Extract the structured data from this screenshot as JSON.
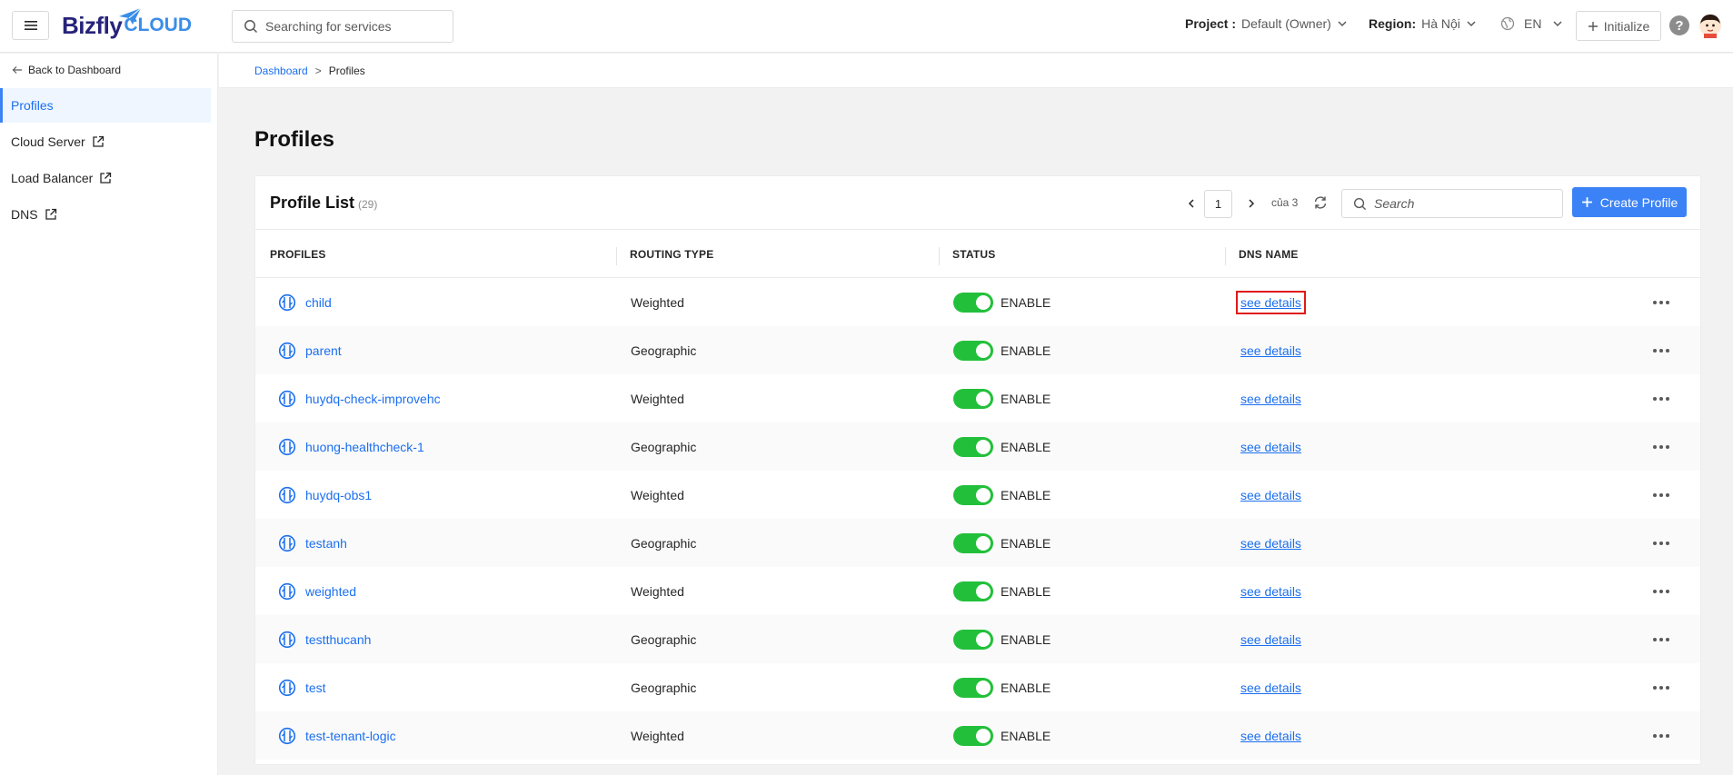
{
  "header": {
    "logo_main": "Bizfly",
    "logo_sub": "CLOUD",
    "search_placeholder": "Searching for services",
    "project_label": "Project :",
    "project_value": "Default (Owner)",
    "region_label": "Region:",
    "region_value": "Hà Nội",
    "language": "EN",
    "initialize_label": "Initialize",
    "help_glyph": "?"
  },
  "sidebar": {
    "back_label": "Back to Dashboard",
    "items": [
      {
        "label": "Profiles",
        "active": true,
        "external": false
      },
      {
        "label": "Cloud Server",
        "active": false,
        "external": true
      },
      {
        "label": "Load Balancer",
        "active": false,
        "external": true
      },
      {
        "label": "DNS",
        "active": false,
        "external": true
      }
    ]
  },
  "breadcrumb": {
    "items": [
      "Dashboard",
      "Profiles"
    ],
    "separator": ">"
  },
  "page": {
    "title": "Profiles"
  },
  "list": {
    "title": "Profile List",
    "count": "(29)",
    "current_page": "1",
    "total_pages": "của 3",
    "search_placeholder": "Search",
    "create_label": "Create Profile",
    "columns": [
      "PROFILES",
      "ROUTING TYPE",
      "STATUS",
      "DNS NAME"
    ],
    "rows": [
      {
        "name": "child",
        "routing": "Weighted",
        "status": "ENABLE",
        "dns": "see details"
      },
      {
        "name": "parent",
        "routing": "Geographic",
        "status": "ENABLE",
        "dns": "see details"
      },
      {
        "name": "huydq-check-improvehc",
        "routing": "Weighted",
        "status": "ENABLE",
        "dns": "see details"
      },
      {
        "name": "huong-healthcheck-1",
        "routing": "Geographic",
        "status": "ENABLE",
        "dns": "see details"
      },
      {
        "name": "huydq-obs1",
        "routing": "Weighted",
        "status": "ENABLE",
        "dns": "see details"
      },
      {
        "name": "testanh",
        "routing": "Geographic",
        "status": "ENABLE",
        "dns": "see details"
      },
      {
        "name": "weighted",
        "routing": "Weighted",
        "status": "ENABLE",
        "dns": "see details"
      },
      {
        "name": "testthucanh",
        "routing": "Geographic",
        "status": "ENABLE",
        "dns": "see details"
      },
      {
        "name": "test",
        "routing": "Geographic",
        "status": "ENABLE",
        "dns": "see details"
      },
      {
        "name": "test-tenant-logic",
        "routing": "Weighted",
        "status": "ENABLE",
        "dns": "see details"
      }
    ]
  },
  "colors": {
    "primary": "#3b82f6",
    "link": "#1b6ff0",
    "toggle_on": "#22c03a",
    "highlight": "#e01919"
  },
  "icons": {
    "menu": "hamburger-icon",
    "search": "search-icon",
    "chevron": "chevron-down-icon",
    "globe": "globe-icon",
    "plus": "plus-icon",
    "back": "arrow-left-icon",
    "external": "external-link-icon",
    "profile": "traffic-profile-icon",
    "refresh": "refresh-icon",
    "more": "more-dots-icon"
  }
}
